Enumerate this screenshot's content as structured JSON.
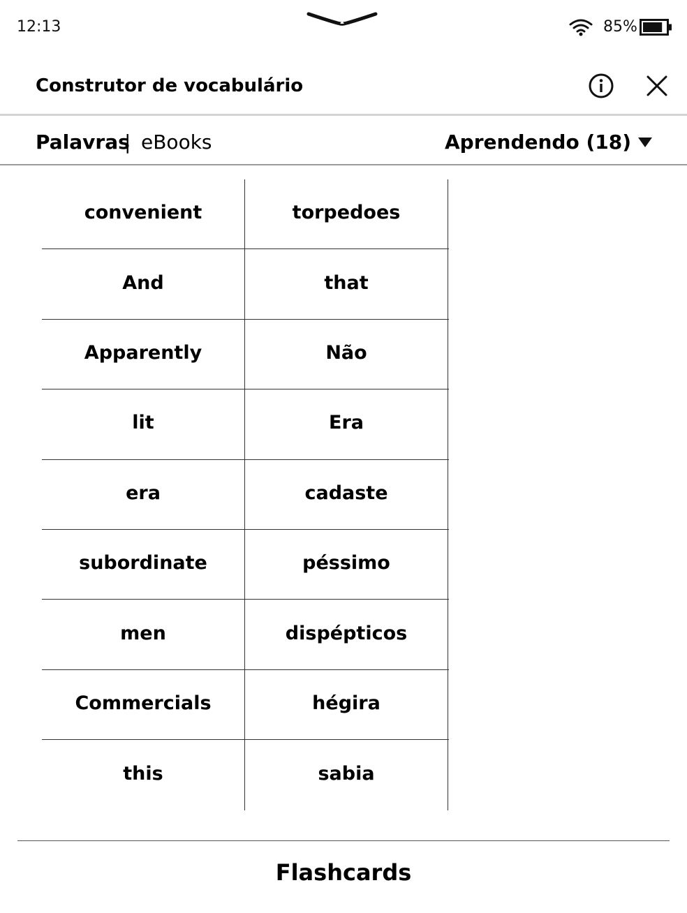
{
  "status_bar": {
    "time": "12:13",
    "battery_percent": "85%",
    "battery_level": 0.85,
    "wifi_icon": "wifi-icon",
    "handle_icon": "chevron-down-icon"
  },
  "header": {
    "title": "Construtor de vocabulário",
    "info_icon": "info-icon",
    "close_icon": "close-icon"
  },
  "subheader": {
    "tabs": [
      {
        "label": "Palavras",
        "active": true
      },
      {
        "label": "eBooks",
        "active": false
      }
    ],
    "separator": "|",
    "filter": {
      "label": "Aprendendo (18)",
      "icon": "caret-down-icon"
    }
  },
  "words": [
    [
      "convenient",
      "torpedoes"
    ],
    [
      "And",
      "that"
    ],
    [
      "Apparently",
      "Não"
    ],
    [
      "lit",
      "Era"
    ],
    [
      "era",
      "cadaste"
    ],
    [
      "subordinate",
      "péssimo"
    ],
    [
      "men",
      "dispépticos"
    ],
    [
      "Commercials",
      "hégira"
    ],
    [
      "this",
      "sabia"
    ]
  ],
  "footer": {
    "flashcards_label": "Flashcards"
  }
}
